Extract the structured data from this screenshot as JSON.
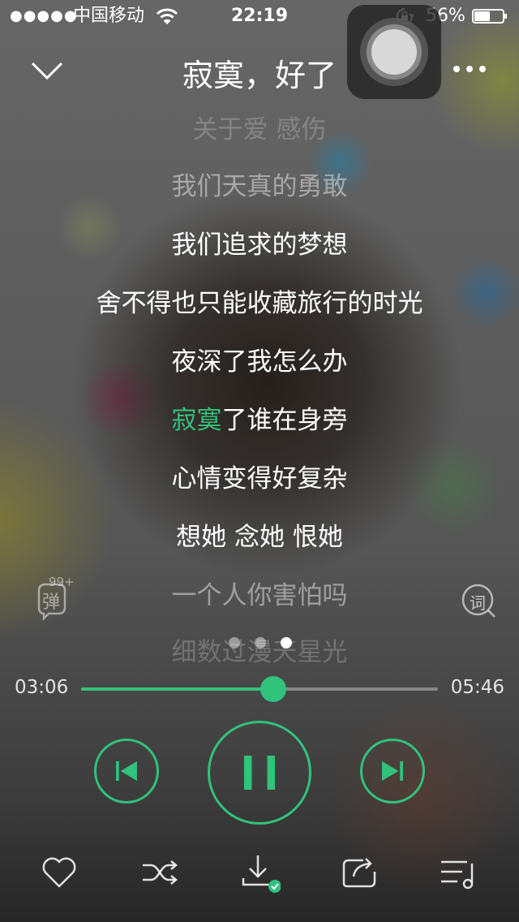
{
  "status_bar": {
    "signal": "●●●●●",
    "carrier": "中国移动",
    "time": "22:19",
    "battery_percent": "56%",
    "battery_level": 0.56,
    "icons": [
      "wifi-icon",
      "rotation-lock-icon",
      "battery-icon"
    ]
  },
  "header": {
    "title": "寂寞，好了",
    "icons": [
      "chevron-down-icon",
      "more-icon",
      "assistive-touch-icon"
    ]
  },
  "lyrics": {
    "lines": [
      "关于爱 感伤",
      "我们天真的勇敢",
      "我们追求的梦想",
      "舍不得也只能收藏旅行的时光",
      "夜深了我怎么办",
      "寂寞了谁在身旁",
      "心情变得好复杂",
      "想她 念她 恨她",
      "一个人你害怕吗",
      "细数过漫天星光"
    ],
    "current_line_sung": "寂寞",
    "current_line_rest": "了谁在身旁"
  },
  "side_buttons": {
    "danmu_label": "弹",
    "danmu_count": "99+",
    "lyric_label": "词"
  },
  "pager": {
    "count": 3,
    "active_index": 2
  },
  "progress": {
    "elapsed": "03:06",
    "total": "05:46",
    "fraction": 0.538
  },
  "controls": [
    "previous-icon",
    "pause-icon",
    "next-icon"
  ],
  "bottom_bar": [
    "heart-icon",
    "shuffle-icon",
    "download-icon",
    "share-icon",
    "playlist-icon"
  ],
  "colors": {
    "accent": "#31c27c",
    "text": "#ffffff"
  }
}
